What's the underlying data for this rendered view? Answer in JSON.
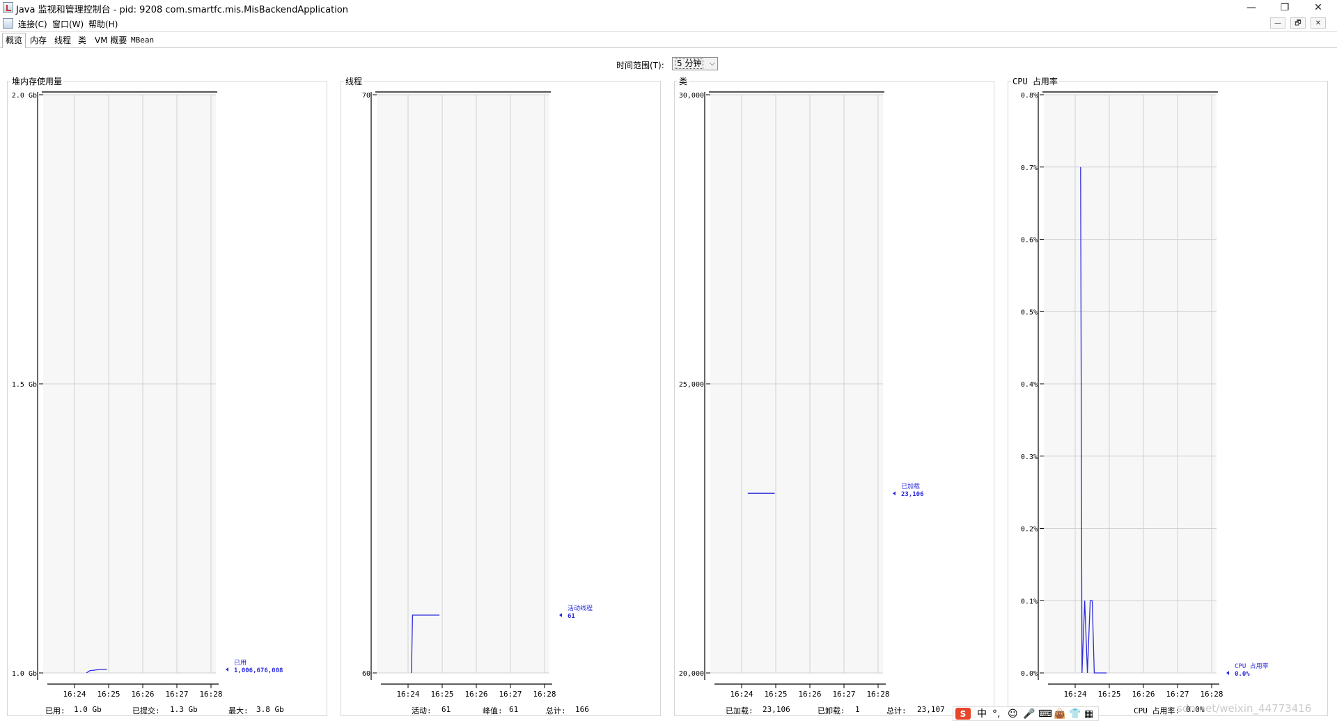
{
  "window": {
    "title": "Java 监视和管理控制台 - pid: 9208 com.smartfc.mis.MisBackendApplication",
    "minimize": "—",
    "maximize": "❐",
    "close": "✕"
  },
  "menu": {
    "items": [
      "连接(C)",
      "窗口(W)",
      "帮助(H)"
    ],
    "inner_buttons": [
      "—",
      "🗗",
      "✕"
    ]
  },
  "tabs": [
    "概览",
    "内存",
    "线程",
    "类",
    "VM 概要",
    "MBean"
  ],
  "active_tab": "概览",
  "toolbar": {
    "time_range_label": "时间范围(T):",
    "time_range_value": "5 分钟"
  },
  "colors": {
    "series": "#2b2bdc",
    "grid": "#d0d0d0",
    "plot_bg": "#f7f7f7"
  },
  "panels": [
    {
      "title": "堆内存使用量",
      "stats": [
        {
          "label": "已用:",
          "value": "1.0  Gb"
        },
        {
          "label": "已提交:",
          "value": "1.3  Gb"
        },
        {
          "label": "最大:",
          "value": "3.8  Gb"
        }
      ]
    },
    {
      "title": "线程",
      "stats": [
        {
          "label": "活动:",
          "value": "61"
        },
        {
          "label": "峰值:",
          "value": "61"
        },
        {
          "label": "总计:",
          "value": "166"
        }
      ]
    },
    {
      "title": "类",
      "stats": [
        {
          "label": "已加载:",
          "value": "23,106"
        },
        {
          "label": "已卸载:",
          "value": "1"
        },
        {
          "label": "总计:",
          "value": "23,107"
        }
      ]
    },
    {
      "title": "CPU 占用率",
      "stats": [
        {
          "label": "CPU 占用率:",
          "value": "0.0%"
        }
      ]
    }
  ],
  "chart_data": [
    {
      "type": "line",
      "y_ticks": [
        {
          "v": 1.0,
          "label": "1.0 Gb"
        },
        {
          "v": 1.5,
          "label": "1.5 Gb"
        },
        {
          "v": 2.0,
          "label": "2.0 Gb"
        }
      ],
      "x_ticks": [
        "16:24",
        "16:25",
        "16:26",
        "16:27",
        "16:28"
      ],
      "ylim": [
        1.0,
        2.0
      ],
      "series": [
        {
          "name": "已用",
          "value_label": "1,006,676,008",
          "points": [
            [
              4.35,
              1.0
            ],
            [
              4.45,
              1.004
            ],
            [
              4.75,
              1.006
            ],
            [
              4.95,
              1.006
            ]
          ]
        }
      ]
    },
    {
      "type": "line",
      "y_ticks": [
        {
          "v": 60,
          "label": "60"
        },
        {
          "v": 70,
          "label": "70"
        }
      ],
      "x_ticks": [
        "16:24",
        "16:25",
        "16:26",
        "16:27",
        "16:28"
      ],
      "ylim": [
        60,
        70
      ],
      "series": [
        {
          "name": "活动线程",
          "value_label": "61",
          "points": [
            [
              4.1,
              60
            ],
            [
              4.13,
              61
            ],
            [
              4.92,
              61
            ]
          ]
        }
      ]
    },
    {
      "type": "line",
      "y_ticks": [
        {
          "v": 20000,
          "label": "20,000"
        },
        {
          "v": 25000,
          "label": "25,000"
        },
        {
          "v": 30000,
          "label": "30,000"
        }
      ],
      "x_ticks": [
        "16:24",
        "16:25",
        "16:26",
        "16:27",
        "16:28"
      ],
      "ylim": [
        20000,
        30000
      ],
      "series": [
        {
          "name": "已加载",
          "value_label": "23,106",
          "points": [
            [
              4.18,
              23106
            ],
            [
              4.97,
              23106
            ]
          ]
        }
      ]
    },
    {
      "type": "line",
      "y_ticks": [
        {
          "v": 0.0,
          "label": "0.0%"
        },
        {
          "v": 0.1,
          "label": "0.1%"
        },
        {
          "v": 0.2,
          "label": "0.2%"
        },
        {
          "v": 0.3,
          "label": "0.3%"
        },
        {
          "v": 0.4,
          "label": "0.4%"
        },
        {
          "v": 0.5,
          "label": "0.5%"
        },
        {
          "v": 0.6,
          "label": "0.6%"
        },
        {
          "v": 0.7,
          "label": "0.7%"
        },
        {
          "v": 0.8,
          "label": "0.8%"
        }
      ],
      "x_ticks": [
        "16:24",
        "16:25",
        "16:26",
        "16:27",
        "16:28"
      ],
      "ylim": [
        0.0,
        0.8
      ],
      "series": [
        {
          "name": "CPU 占用率",
          "value_label": "0.0%",
          "points": [
            [
              4.16,
              0.7
            ],
            [
              4.2,
              0.0
            ],
            [
              4.28,
              0.1
            ],
            [
              4.36,
              0.0
            ],
            [
              4.44,
              0.1
            ],
            [
              4.5,
              0.1
            ],
            [
              4.56,
              0.0
            ],
            [
              4.92,
              0.0
            ]
          ]
        }
      ]
    }
  ],
  "ime": {
    "logo": "S",
    "items": [
      "中",
      "°,",
      "☺",
      "🎤",
      "⌨",
      "👜",
      "👕",
      "▦"
    ]
  },
  "watermark": "sdn.net/weixin_44773416"
}
